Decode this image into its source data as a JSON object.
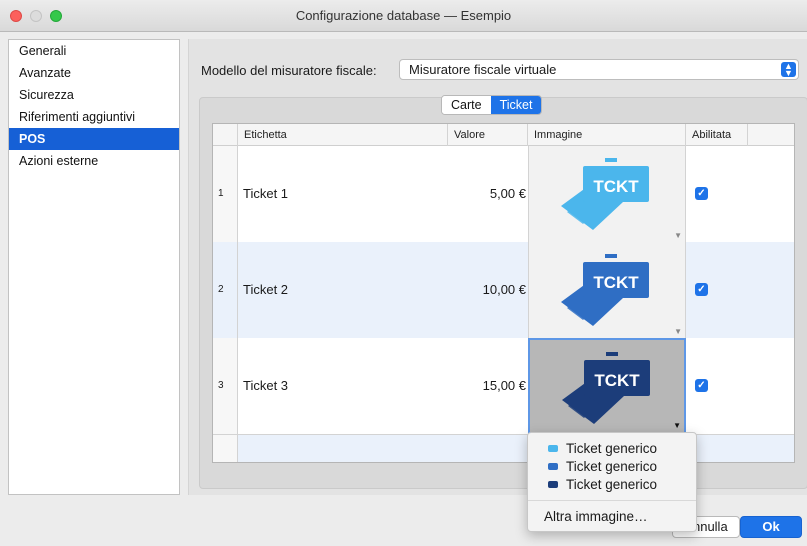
{
  "window": {
    "title": "Configurazione database — Esempio"
  },
  "sidebar": {
    "items": [
      {
        "label": "Generali"
      },
      {
        "label": "Avanzate"
      },
      {
        "label": "Sicurezza"
      },
      {
        "label": "Riferimenti aggiuntivi"
      },
      {
        "label": "POS"
      },
      {
        "label": "Azioni esterne"
      }
    ],
    "selected": "POS"
  },
  "main": {
    "modello_label": "Modello del misuratore fiscale:",
    "modello_value": "Misuratore fiscale virtuale",
    "tabs": [
      {
        "label": "Carte"
      },
      {
        "label": "Ticket"
      }
    ],
    "active_tab": "Ticket",
    "table": {
      "columns": [
        "Etichetta",
        "Valore",
        "Immagine",
        "Abilitata"
      ],
      "rows": [
        {
          "num": "1",
          "label": "Ticket 1",
          "value": "5,00 €",
          "image_text": "TCKT",
          "image_color": "#4bb6ec",
          "enabled": true
        },
        {
          "num": "2",
          "label": "Ticket 2",
          "value": "10,00 €",
          "image_text": "TCKT",
          "image_color": "#2f6ec4",
          "enabled": true
        },
        {
          "num": "3",
          "label": "Ticket 3",
          "value": "15,00 €",
          "image_text": "TCKT",
          "image_color": "#1c3d7a",
          "enabled": true
        }
      ]
    }
  },
  "popup_menu": {
    "items": [
      {
        "label": "Ticket generico",
        "icon_color": "#4bb6ec"
      },
      {
        "label": "Ticket generico",
        "icon_color": "#2f6ec4"
      },
      {
        "label": "Ticket generico",
        "icon_color": "#1c3d7a"
      }
    ],
    "other_label": "Altra immagine…"
  },
  "buttons": {
    "cancel": "Annulla",
    "ok": "Ok"
  },
  "colors": {
    "accent": "#1e73e8",
    "selection": "#1660d6"
  }
}
